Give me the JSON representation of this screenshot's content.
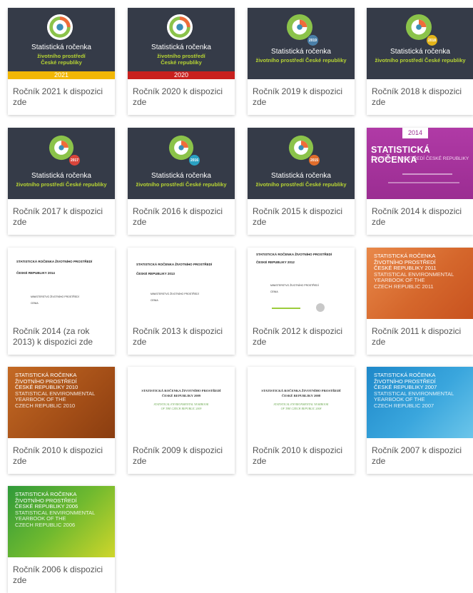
{
  "cards": [
    {
      "caption": "Ročník 2021 k dispozici zde",
      "cover_title": "Statistická ročenka",
      "cover_subtitle": [
        "životního prostředí",
        "České republiky"
      ],
      "stripe_text": "2021",
      "stripe_color": "#f2b705"
    },
    {
      "caption": "Ročník 2020 k dispozici zde",
      "cover_title": "Statistická ročenka",
      "cover_subtitle": [
        "životního prostředí",
        "České republiky"
      ],
      "stripe_text": "2020",
      "stripe_color": "#c8201e"
    },
    {
      "caption": "Ročník 2019 k dispozici zde",
      "cover_title": "Statistická ročenka",
      "cover_subtitle": [
        "životního prostředí České republiky"
      ],
      "badge": "2019",
      "badge_color": "#4a7fa8"
    },
    {
      "caption": "Ročník 2018 k dispozici zde",
      "cover_title": "Statistická ročenka",
      "cover_subtitle": [
        "životního prostředí České republiky"
      ],
      "badge": "2018",
      "badge_color": "#e3b41a"
    },
    {
      "caption": "Ročník 2017 k dispozici zde",
      "cover_title": "Statistická ročenka",
      "cover_subtitle": [
        "životního prostředí České republiky"
      ],
      "badge": "2017",
      "badge_color": "#d9453b"
    },
    {
      "caption": "Ročník 2016 k dispozici zde",
      "cover_title": "Statistická ročenka",
      "cover_subtitle": [
        "životního prostředí České republiky"
      ],
      "badge": "2016",
      "badge_color": "#2aa1c2"
    },
    {
      "caption": "Ročník 2015 k dispozici zde",
      "cover_title": "Statistická ročenka",
      "cover_subtitle": [
        "životního prostředí České republiky"
      ],
      "badge": "2015",
      "badge_color": "#e06d2c"
    },
    {
      "caption": "Ročník 2014 k dispozici zde",
      "cover_year": "2014",
      "cover_title": "STATISTICKÁ ROČENKA",
      "cover_subtitle": "ŽIVOTNÍHO PROSTŘEDÍ ČESKÉ REPUBLIKY"
    },
    {
      "caption": "Ročník 2014 (za rok 2013) k dispozici zde",
      "cover_title": [
        "STATISTICKÁ ROČENKA ŽIVOTNÍHO PROSTŘEDÍ",
        "ČESKÉ REPUBLIKY 2014"
      ],
      "cover_small": [
        "MINISTERSTVO ŽIVOTNÍHO PROSTŘEDÍ",
        "CENIA"
      ]
    },
    {
      "caption": "Ročník 2013 k dispozici zde",
      "cover_title": [
        "STATISTICKÁ ROČENKA ŽIVOTNÍHO PROSTŘEDÍ",
        "ČESKÉ REPUBLIKY 2013"
      ],
      "cover_small": [
        "MINISTERSTVO ŽIVOTNÍHO PROSTŘEDÍ",
        "CENIA"
      ]
    },
    {
      "caption": "Ročník 2012 k dispozici zde",
      "cover_title": [
        "STATISTICKÁ ROČENKA ŽIVOTNÍHO PROSTŘEDÍ",
        "ČESKÉ REPUBLIKY 2012"
      ],
      "cover_small": [
        "MINISTERSTVO ŽIVOTNÍHO PROSTŘEDÍ",
        "CENIA"
      ]
    },
    {
      "caption": "Ročník 2011 k dispozici zde",
      "cover_lines": [
        "STATISTICKÁ ROČENKA",
        "ŽIVOTNÍHO PROSTŘEDÍ",
        "ČESKÉ REPUBLIKY 2011"
      ],
      "cover_lines_en": [
        "STATISTICAL ENVIRONMENTAL",
        "YEARBOOK OF THE",
        "CZECH REPUBLIC 2011"
      ],
      "gradient": [
        "#e9894a",
        "#c8521f"
      ]
    },
    {
      "caption": "Ročník 2010 k dispozici zde",
      "cover_lines": [
        "STATISTICKÁ ROČENKA",
        "ŽIVOTNÍHO PROSTŘEDÍ",
        "ČESKÉ REPUBLIKY 2010"
      ],
      "cover_lines_en": [
        "STATISTICAL ENVIRONMENTAL",
        "YEARBOOK OF THE",
        "CZECH REPUBLIC 2010"
      ],
      "gradient": [
        "#c46a24",
        "#8a3d10"
      ]
    },
    {
      "caption": "Ročník 2009 k dispozici zde",
      "cover_title": [
        "STATISTICKÁ ROČENKA ŽIVOTNÍHO PROSTŘEDÍ",
        "ČESKÉ REPUBLIKY 2009"
      ],
      "cover_en": [
        "STATISTICAL ENVIRONMENTAL YEARBOOK",
        "OF THE CZECH REPUBLIC 2009"
      ]
    },
    {
      "caption": "Ročník 2010 k dispozici zde",
      "cover_title": [
        "STATISTICKÁ ROČENKA ŽIVOTNÍHO PROSTŘEDÍ",
        "ČESKÉ REPUBLIKY 2008"
      ],
      "cover_en": [
        "STATISTICAL ENVIRONMENTAL YEARBOOK",
        "OF THE CZECH REPUBLIC 2008"
      ]
    },
    {
      "caption": "Ročník 2007 k dispozici zde",
      "cover_lines": [
        "STATISTICKÁ ROČENKA",
        "ŽIVOTNÍHO PROSTŘEDÍ",
        "ČESKÉ REPUBLIKY 2007"
      ],
      "cover_lines_en": [
        "STATISTICAL ENVIRONMENTAL",
        "YEARBOOK OF THE",
        "CZECH REPUBLIC 2007"
      ],
      "gradient": [
        "#1e88c9",
        "#6cc6ea"
      ]
    },
    {
      "caption": "Ročník 2006 k dispozici zde",
      "cover_lines": [
        "STATISTICKÁ ROČENKA",
        "ŽIVOTNÍHO PROSTŘEDÍ",
        "ČESKÉ REPUBLIKY 2006"
      ],
      "cover_lines_en": [
        "STATISTICAL ENVIRONMENTAL",
        "YEARBOOK OF THE",
        "CZECH REPUBLIC 2006"
      ],
      "gradient": [
        "#2f9a3a",
        "#cfd62b"
      ]
    }
  ]
}
